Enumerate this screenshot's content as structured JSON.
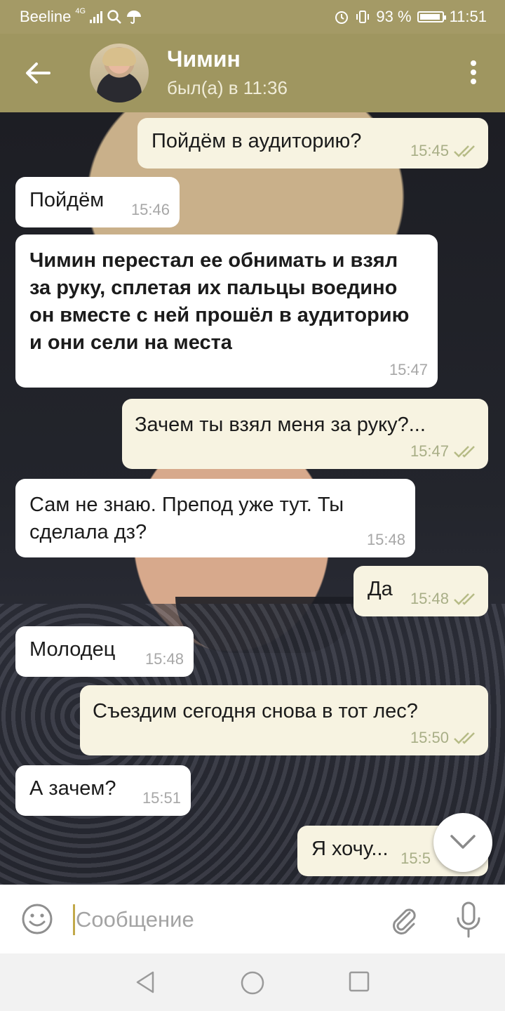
{
  "status_bar": {
    "carrier": "Beeline",
    "network": "4G",
    "battery": "93 %",
    "time": "11:51"
  },
  "header": {
    "contact_name": "Чимин",
    "contact_status": "был(а) в 11:36"
  },
  "messages": [
    {
      "dir": "out",
      "text": "Пойдём в аудиторию?",
      "time": "15:45"
    },
    {
      "dir": "in",
      "text": "Пойдём",
      "time": "15:46"
    },
    {
      "dir": "in",
      "text": "Чимин перестал ее обнимать и взял за руку, сплетая их пальцы воедино он вместе с ней прошёл в аудиторию и они сели на места",
      "time": "15:47"
    },
    {
      "dir": "out",
      "text": "Зачем ты взял меня за руку?...",
      "time": "15:47"
    },
    {
      "dir": "in",
      "text": "Сам не знаю. Препод уже тут. Ты сделала дз?",
      "time": "15:48"
    },
    {
      "dir": "out",
      "text": "Да",
      "time": "15:48"
    },
    {
      "dir": "in",
      "text": "Молодец",
      "time": "15:48"
    },
    {
      "dir": "out",
      "text": "Съездим сегодня снова в тот лес?",
      "time": "15:50"
    },
    {
      "dir": "in",
      "text": "А зачем?",
      "time": "15:51"
    },
    {
      "dir": "out",
      "text": "Я хочу...",
      "time": "15:5"
    }
  ],
  "input": {
    "placeholder": "Сообщение"
  },
  "colors": {
    "header": "#9f9660",
    "status_bar": "#a49a66",
    "incoming_bubble": "#ffffff",
    "outgoing_bubble": "#f7f3e1",
    "read_check": "#a8ae86"
  }
}
